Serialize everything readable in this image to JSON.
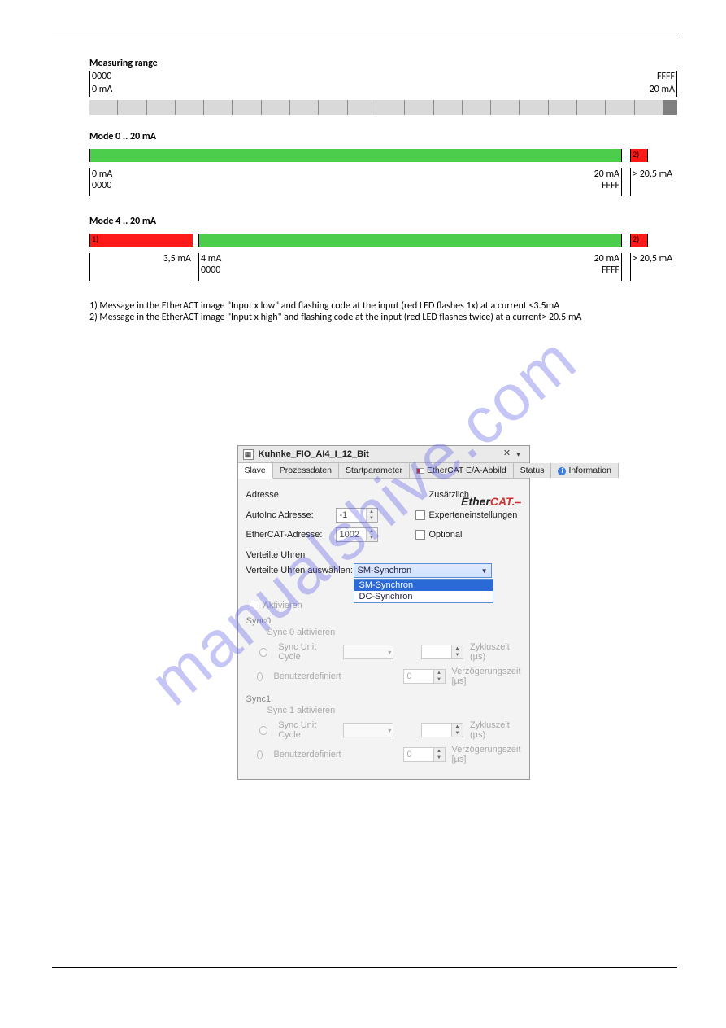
{
  "watermark": "manualshive.com",
  "section1": {
    "title": "Measuring range",
    "hex_start": "0000",
    "hex_end": "FFFF",
    "ma_start": "0 mA",
    "ma_end": "20 mA"
  },
  "section2": {
    "title": "Mode 0 .. 20 mA",
    "note_right": "2)",
    "left_ma": "0 mA",
    "left_hex": "0000",
    "right_ma": "20 mA",
    "right_hex": "FFFF",
    "over_ma": "> 20,5 mA"
  },
  "section3": {
    "title": "Mode 4 .. 20 mA",
    "note_left": "1)",
    "note_right": "2)",
    "under_ma": "3,5 mA",
    "left_ma": "4 mA",
    "left_hex": "0000",
    "right_ma": "20 mA",
    "right_hex": "FFFF",
    "over_ma": "> 20,5 mA"
  },
  "footnotes": {
    "n1": "1) Message in the EtherACT image \"Input x low\" and flashing code at the input (red LED flashes 1x) at a current <3.5mA",
    "n2": "2) Message in the EtherACT image \"Input x high\" and flashing code at the input (red LED flashes twice) at a current> 20.5 mA"
  },
  "dialog": {
    "title": "Kuhnke_FIO_AI4_I_12_Bit",
    "tabs": {
      "slave": "Slave",
      "prozess": "Prozessdaten",
      "start": "Startparameter",
      "ethercat": "EtherCAT E/A-Abbild",
      "status": "Status",
      "info": "Information"
    },
    "logo": "EtherCAT.",
    "adresse_heading": "Adresse",
    "zusatz_heading": "Zusätzlich",
    "autoinc_label": "AutoInc Adresse:",
    "autoinc_value": "-1",
    "ethercat_addr_label": "EtherCAT-Adresse:",
    "ethercat_addr_value": "1002",
    "expert_label": "Experteneinstellungen",
    "optional_label": "Optional",
    "dc_heading": "Verteilte Uhren",
    "dc_select_label": "Verteilte Uhren auswählen:",
    "dc_selected": "SM-Synchron",
    "dc_opt_sm": "SM-Synchron",
    "dc_opt_dc": "DC-Synchron",
    "activate_label": "Aktivieren",
    "sync0_heading": "Sync0:",
    "sync0_activate": "Sync 0 aktivieren",
    "sync_unit_cycle": "Sync Unit Cycle",
    "benutzer": "Benutzerdefiniert",
    "zykluszeit": "Zykluszeit (µs)",
    "verzog": "Verzögerungszeit [µs]",
    "sync1_heading": "Sync1:",
    "sync1_activate": "Sync 1 aktivieren",
    "zero": "0"
  }
}
